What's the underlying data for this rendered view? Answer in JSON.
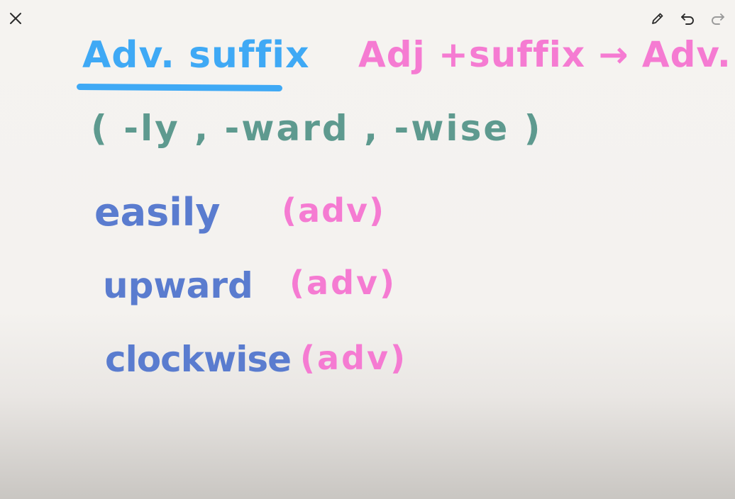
{
  "toolbar": {
    "close_icon": "close-icon",
    "pen_icon": "pencil-icon",
    "undo_icon": "undo-icon",
    "redo_icon": "redo-icon"
  },
  "colors": {
    "title": "#3fa9f5",
    "pink": "#f57bd2",
    "teal": "#5e9a8f",
    "blue": "#5a7ccf",
    "toolbar_icon": "#2b2b2b",
    "toolbar_disabled": "#9a9a9a"
  },
  "canvas": {
    "title": "Adv. suffix",
    "formula": "Adj +suffix → Adv.",
    "suffix_list": "( -ly , -ward , -wise )",
    "examples": [
      {
        "word": "easily",
        "tag": "(adv)"
      },
      {
        "word": "upward",
        "tag": "(adv)"
      },
      {
        "word": "clockwise",
        "tag": "(adv)"
      }
    ]
  }
}
